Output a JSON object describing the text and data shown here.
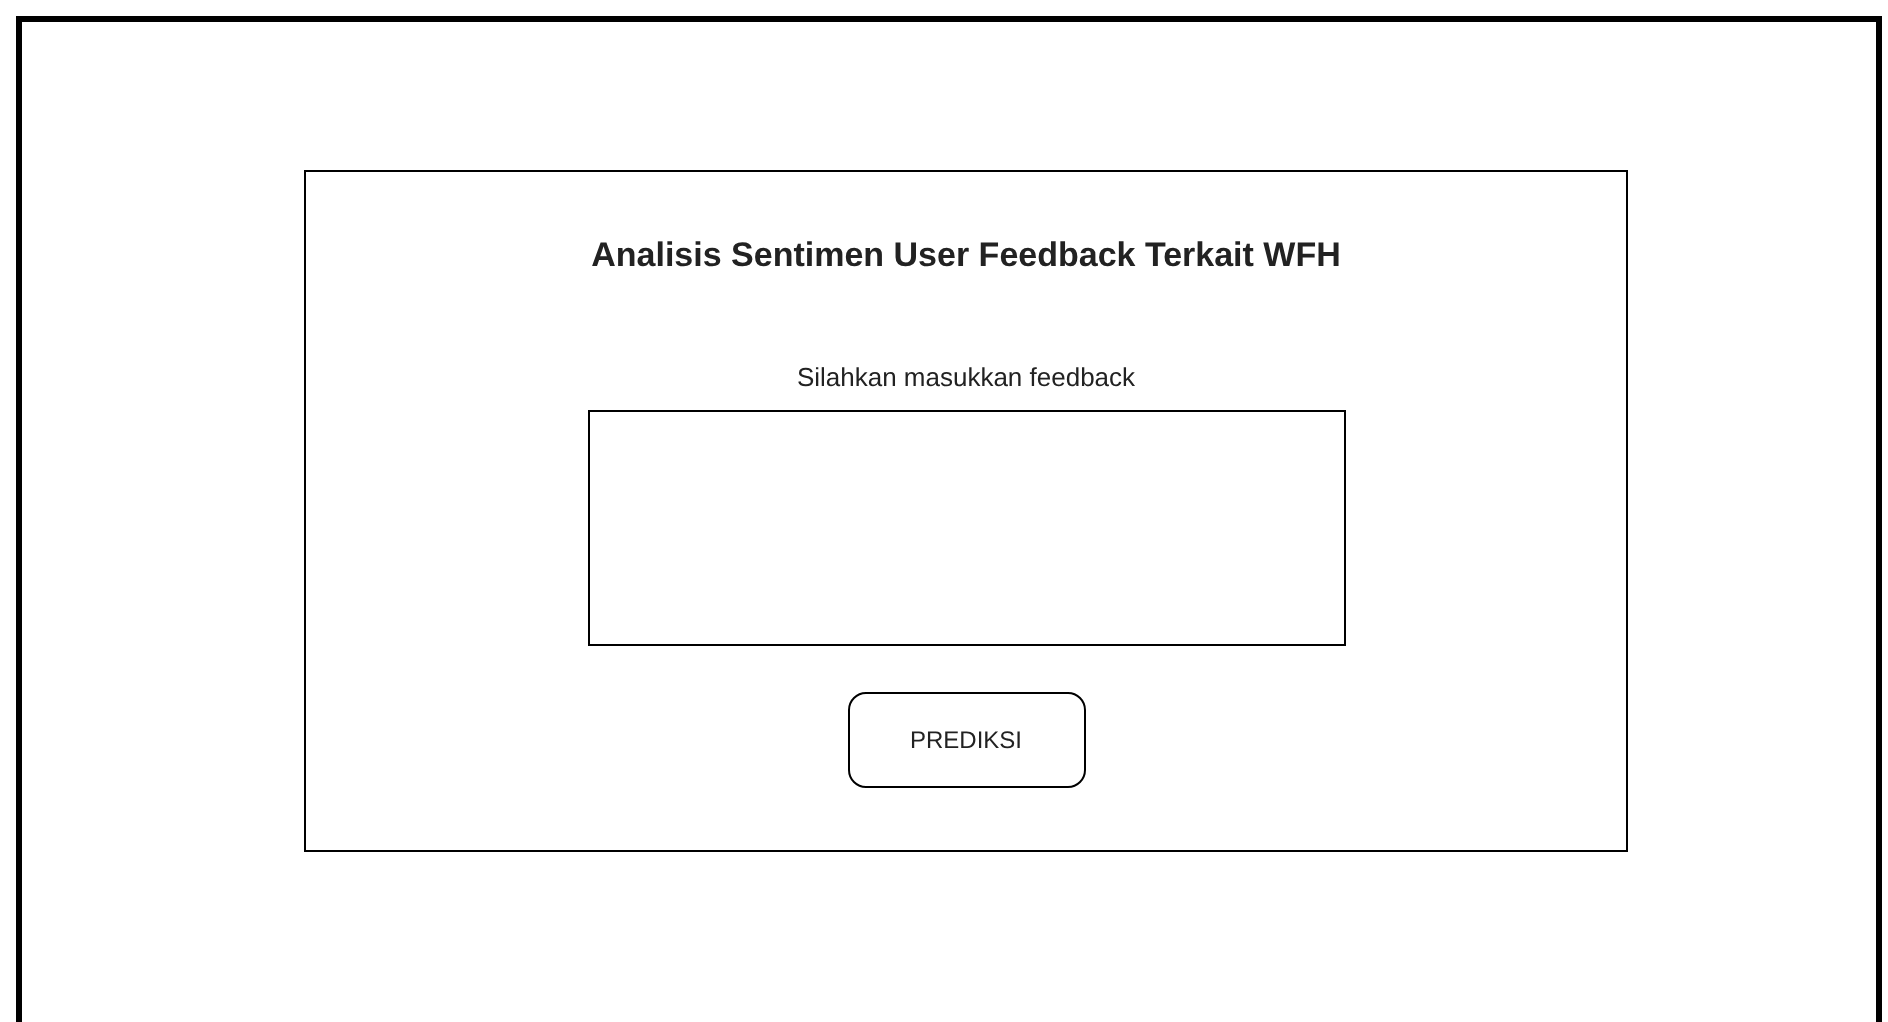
{
  "card": {
    "title": "Analisis Sentimen User Feedback Terkait WFH",
    "prompt": "Silahkan masukkan feedback",
    "button": "PREDIKSI"
  }
}
